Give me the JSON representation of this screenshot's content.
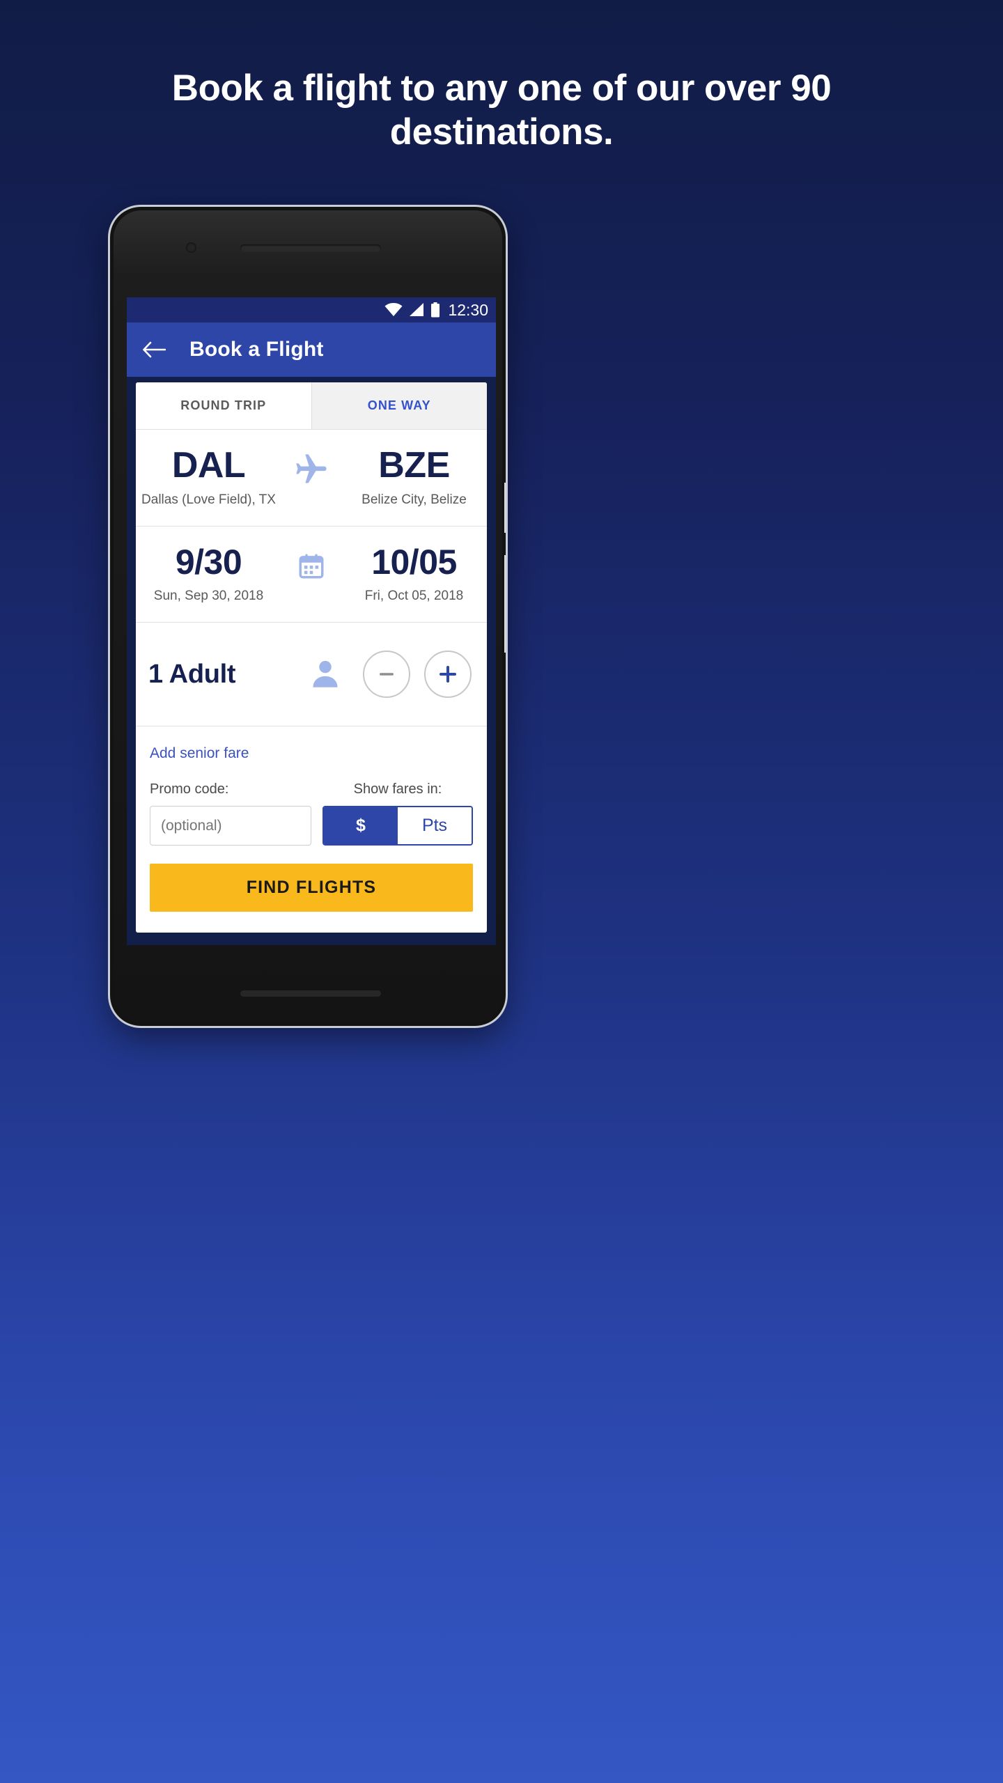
{
  "promo": {
    "headline": "Book a flight to any one of our over 90 destinations."
  },
  "status_bar": {
    "wifi_icon": "wifi-icon",
    "signal_icon": "signal-icon",
    "battery_icon": "battery-icon",
    "time": "12:30"
  },
  "app_bar": {
    "back_icon": "back-arrow-icon",
    "title": "Book a Flight"
  },
  "tabs": [
    {
      "label": "ROUND TRIP",
      "selected": true
    },
    {
      "label": "ONE WAY",
      "selected": false
    }
  ],
  "route": {
    "origin_code": "DAL",
    "origin_city": "Dallas (Love Field), TX",
    "plane_icon": "airplane-icon",
    "destination_code": "BZE",
    "destination_city": "Belize City, Belize"
  },
  "dates": {
    "depart_short": "9/30",
    "depart_long": "Sun, Sep 30, 2018",
    "calendar_icon": "calendar-icon",
    "return_short": "10/05",
    "return_long": "Fri, Oct 05, 2018"
  },
  "passengers": {
    "label": "1 Adult",
    "person_icon": "person-icon",
    "decrement_icon": "minus-icon",
    "increment_icon": "plus-icon"
  },
  "senior_fare": {
    "link_label": "Add senior fare"
  },
  "promo_code": {
    "label": "Promo code:",
    "value": "",
    "placeholder": "(optional)"
  },
  "show_fares": {
    "label": "Show fares in:",
    "options": [
      {
        "label": "$",
        "selected": true
      },
      {
        "label": "Pts",
        "selected": false
      }
    ]
  },
  "cta": {
    "label": "FIND FLIGHTS"
  },
  "colors": {
    "background_top": "#111c46",
    "background_bottom": "#3457c4",
    "status_bar": "#1d2a72",
    "app_bar": "#2d46a8",
    "navy_text": "#16214f",
    "link_blue": "#3a52c0",
    "tab_blue": "#3452cc",
    "cta_yellow": "#f9b81c",
    "icon_periwinkle": "#9fb4e8"
  }
}
